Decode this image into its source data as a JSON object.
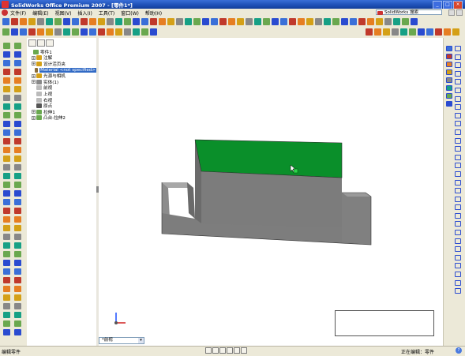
{
  "window": {
    "title": "SolidWorks Office Premium 2007 - [零件1*]"
  },
  "menu": {
    "items": [
      "文件(F)",
      "编辑(E)",
      "视图(V)",
      "插入(I)",
      "工具(T)",
      "窗口(W)",
      "帮助(H)"
    ],
    "search_value": "SolidWorks 搜索"
  },
  "feature_tree": {
    "rows": [
      {
        "label": "零件1",
        "indent": 0,
        "expand": "",
        "icon_color": "#6aa84f",
        "selected": false
      },
      {
        "label": "注解",
        "indent": 1,
        "expand": "+",
        "icon_color": "#d4a017",
        "selected": false
      },
      {
        "label": "设计活页夹",
        "indent": 1,
        "expand": "+",
        "icon_color": "#d4a017",
        "selected": false
      },
      {
        "label": "Material <not specified>",
        "indent": 1,
        "expand": "",
        "icon_color": "#8a6d3b",
        "selected": true
      },
      {
        "label": "光源与相机",
        "indent": 1,
        "expand": "+",
        "icon_color": "#d4a017",
        "selected": false
      },
      {
        "label": "实体(1)",
        "indent": 1,
        "expand": "+",
        "icon_color": "#888888",
        "selected": false
      },
      {
        "label": "前视",
        "indent": 1,
        "expand": "",
        "icon_color": "#bbbbbb",
        "selected": false
      },
      {
        "label": "上视",
        "indent": 1,
        "expand": "",
        "icon_color": "#bbbbbb",
        "selected": false
      },
      {
        "label": "右视",
        "indent": 1,
        "expand": "",
        "icon_color": "#bbbbbb",
        "selected": false
      },
      {
        "label": "原点",
        "indent": 1,
        "expand": "",
        "icon_color": "#555555",
        "selected": false
      },
      {
        "label": "拉伸1",
        "indent": 1,
        "expand": "+",
        "icon_color": "#6aa84f",
        "selected": false
      },
      {
        "label": "凸台-拉伸2",
        "indent": 1,
        "expand": "+",
        "icon_color": "#6aa84f",
        "selected": false
      }
    ]
  },
  "viewport": {
    "model_face_color": "#7a7a7a",
    "selected_face_color": "#0a8f2a"
  },
  "view_combo": {
    "value": "*前视"
  },
  "status": {
    "left_text": "编辑零件",
    "mid_buttons": [
      "",
      "",
      "",
      "",
      "",
      ""
    ],
    "right_text": "正在编辑：零件",
    "help_icon": "?"
  },
  "colors": {
    "titlebar": "#1d4fb5",
    "chrome": "#ece9d8",
    "accent_blue": "#316ac5",
    "green_face": "#0a8f2a"
  }
}
